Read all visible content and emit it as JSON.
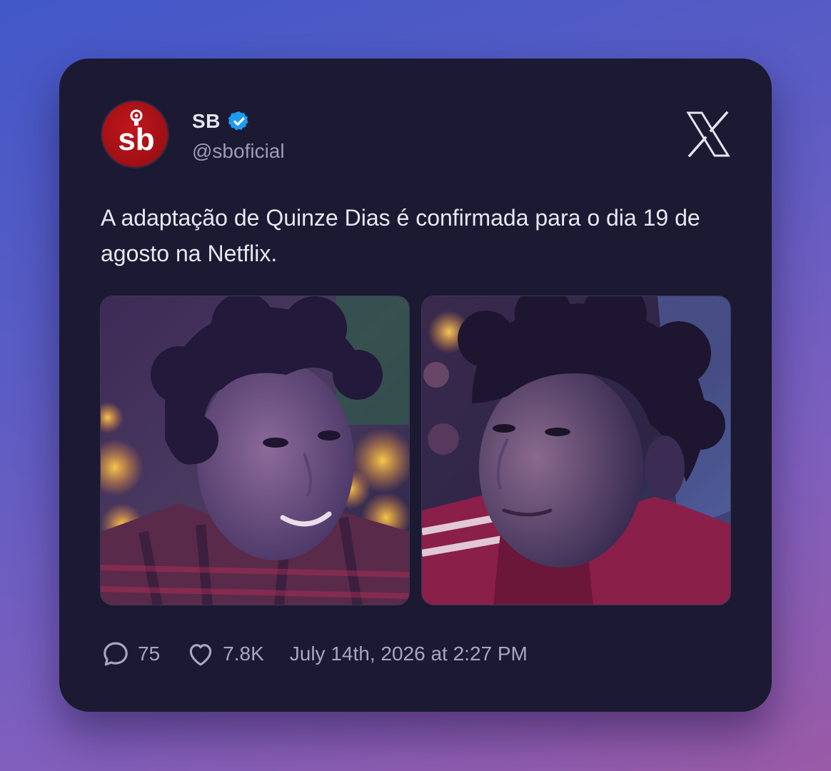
{
  "account": {
    "name": "SB",
    "handle": "@sboficial",
    "verified": true,
    "avatar_text": "sb"
  },
  "platform_icon": "x-logo-icon",
  "tweet": {
    "text": "A adaptação de Quinze Dias é confirmada para o dia 19 de agosto na Netflix."
  },
  "media": [
    {
      "icon": "photo-left"
    },
    {
      "icon": "photo-right"
    }
  ],
  "footer": {
    "replies": "75",
    "likes": "7.8K",
    "timestamp": "July 14th, 2026 at 2:27 PM"
  },
  "colors": {
    "card_bg": "#1c1a33",
    "verified_badge": "#1d9bf0",
    "avatar_red": "#b0131a"
  }
}
